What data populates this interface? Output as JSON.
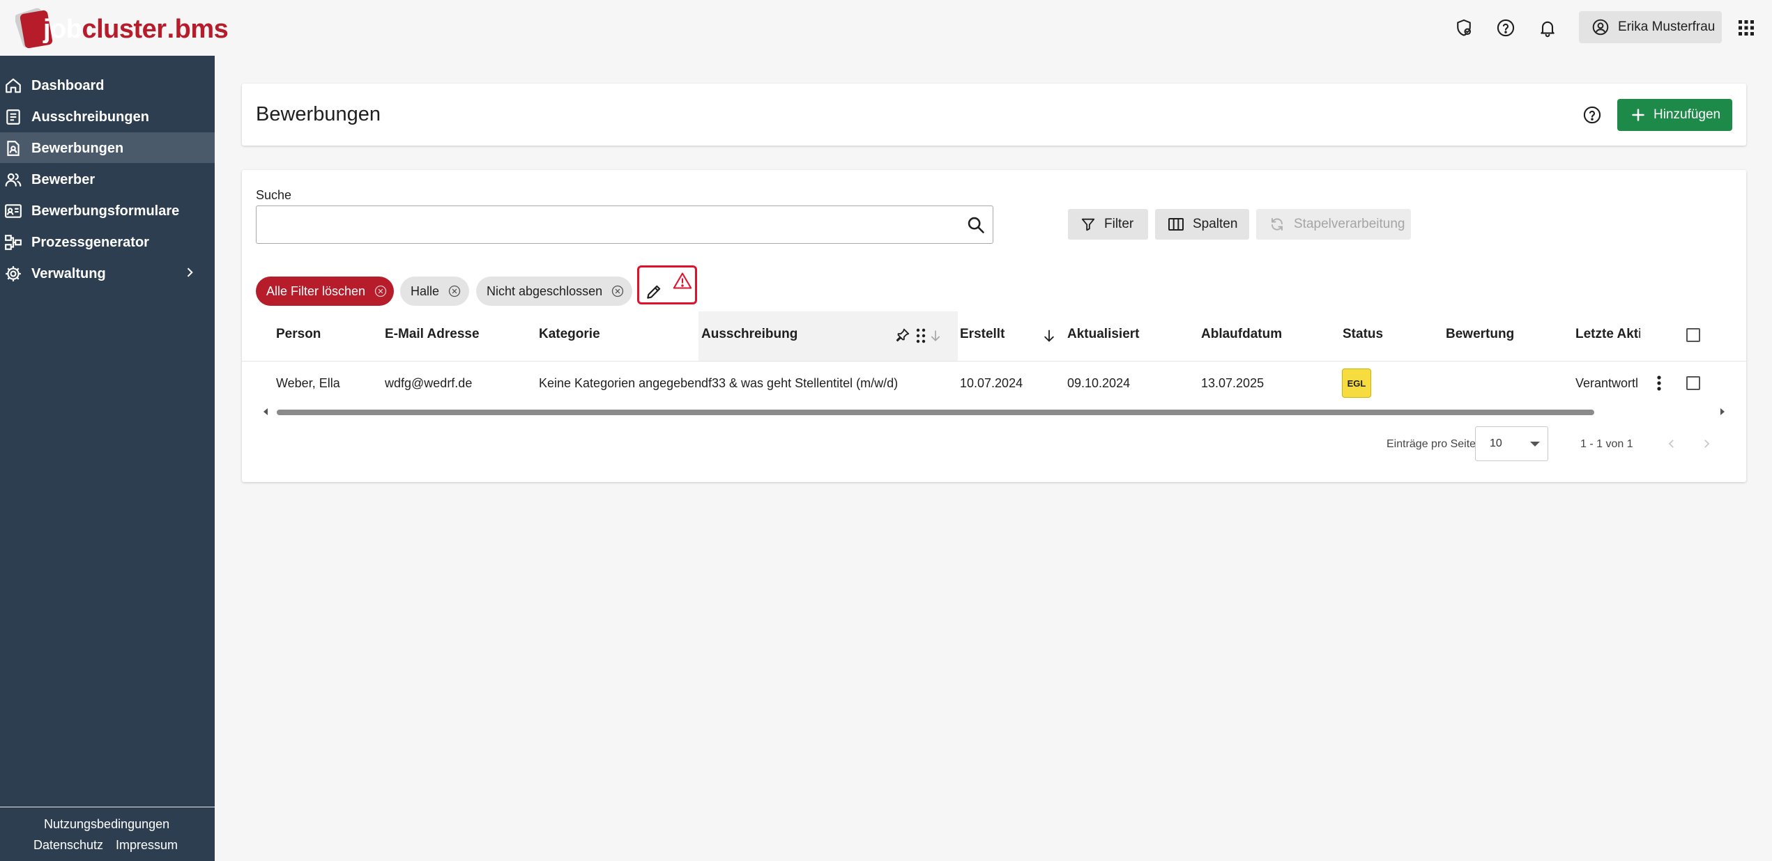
{
  "brand": {
    "job": "job",
    "cluster": "cluster",
    "dot": ".",
    "bms": "bms",
    "color": "#b71c2b"
  },
  "topbar": {
    "user_name": "Erika Musterfrau"
  },
  "sidebar": {
    "items": [
      {
        "label": "Dashboard",
        "icon": "home-icon"
      },
      {
        "label": "Ausschreibungen",
        "icon": "document-icon"
      },
      {
        "label": "Bewerbungen",
        "icon": "application-icon",
        "active": true
      },
      {
        "label": "Bewerber",
        "icon": "people-icon"
      },
      {
        "label": "Bewerbungsformulare",
        "icon": "id-card-icon"
      },
      {
        "label": "Prozessgenerator",
        "icon": "process-icon"
      },
      {
        "label": "Verwaltung",
        "icon": "gear-icon"
      }
    ],
    "footer": {
      "terms": "Nutzungsbedingungen",
      "privacy": "Datenschutz",
      "imprint": "Impressum"
    },
    "bg_color": "#2d3e50"
  },
  "header": {
    "title": "Bewerbungen",
    "add_label": "Hinzufügen",
    "add_color": "#1d8a4a"
  },
  "search": {
    "label": "Suche",
    "value": "",
    "placeholder": ""
  },
  "toolbar": {
    "filter_label": "Filter",
    "columns_label": "Spalten",
    "batch_label": "Stapelverarbeitung"
  },
  "chips": {
    "clear_all": "Alle Filter löschen",
    "halle": "Halle",
    "not_closed": "Nicht abgeschlossen"
  },
  "table": {
    "headers": {
      "person": "Person",
      "email": "E-Mail Adresse",
      "category": "Kategorie",
      "posting": "Ausschreibung",
      "created": "Erstellt",
      "updated": "Aktualisiert",
      "expiry": "Ablaufdatum",
      "status": "Status",
      "rating": "Bewertung",
      "last_action": "Letzte Akti"
    },
    "rows": [
      {
        "person": "Weber, Ella",
        "email": "wdfg@wedrf.de",
        "category": "Keine Kategorien angegeben",
        "posting": "df33 & was geht Stellentitel (m/w/d)",
        "created": "10.07.2024",
        "updated": "09.10.2024",
        "expiry": "13.07.2025",
        "status": "EGL",
        "rating": "",
        "last_action": "Verantwortl"
      }
    ]
  },
  "pagination": {
    "per_page_label": "Einträge pro Seite",
    "per_page_value": "10",
    "range": "1 - 1 von 1"
  }
}
